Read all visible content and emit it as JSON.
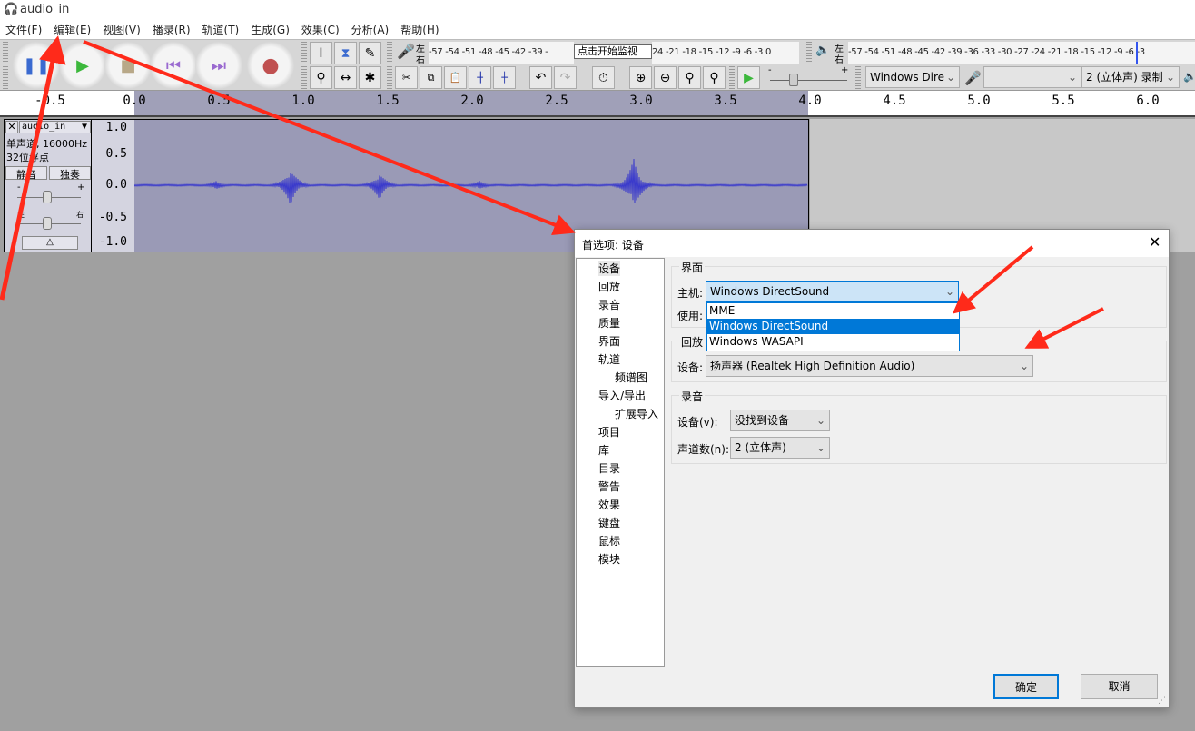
{
  "window": {
    "title": "audio_in"
  },
  "menu": [
    "文件(F)",
    "编辑(E)",
    "视图(V)",
    "播录(R)",
    "轨道(T)",
    "生成(G)",
    "效果(C)",
    "分析(A)",
    "帮助(H)"
  ],
  "toolbar": {
    "rec_meter_lr": [
      "左",
      "右"
    ],
    "rec_meter_scale": "-57 -54 -51 -48 -45 -42 -39 -",
    "rec_meter_scale2": "24 -21 -18 -15 -12  -9  -6  -3  0",
    "monitor_hint": "点击开始监视",
    "play_meter_lr": [
      "左",
      "右"
    ],
    "play_meter_scale": "-57 -54 -51 -48 -45 -42 -39 -36 -33 -30 -27 -24 -21 -18 -15 -12  -9  -6  -3",
    "speed_min": "-",
    "speed_max": "+",
    "host": "Windows Dire",
    "rec_device": "",
    "channels": "2 (立体声) 录制"
  },
  "ruler": {
    "ticks": [
      "-0.5",
      "0.0",
      "0.5",
      "1.0",
      "1.5",
      "2.0",
      "2.5",
      "3.0",
      "3.5",
      "4.0",
      "4.5",
      "5.0",
      "5.5",
      "6.0"
    ]
  },
  "track": {
    "name": "audio_in",
    "info1": "单声道, 16000Hz",
    "info2": "32位浮点",
    "mute": "静音",
    "solo": "独奏",
    "gain_min": "-",
    "gain_max": "+",
    "pan_left": "左",
    "pan_right": "右",
    "scale": [
      "1.0",
      "0.5",
      "0.0",
      "-0.5",
      "-1.0"
    ]
  },
  "dialog": {
    "title": "首选项: 设备",
    "tree": [
      "设备",
      "回放",
      "录音",
      "质量",
      "界面",
      "轨道",
      "频谱图",
      "导入/导出",
      "扩展导入",
      "项目",
      "库",
      "目录",
      "警告",
      "效果",
      "键盘",
      "鼠标",
      "模块"
    ],
    "interface_group": "界面",
    "host_label": "主机:",
    "host_value": "Windows DirectSound",
    "use_label": "使用:",
    "host_options": [
      "MME",
      "Windows DirectSound",
      "Windows WASAPI"
    ],
    "playback_group": "回放",
    "playback_device_label": "设备:",
    "playback_device": "扬声器 (Realtek High Definition Audio)",
    "recording_group": "录音",
    "recording_device_label": "设备(v):",
    "recording_device": "没找到设备",
    "channels_label": "声道数(n):",
    "channels_value": "2 (立体声)",
    "ok": "确定",
    "cancel": "取消"
  },
  "colors": {
    "annotation_arrow": "#ff2a1a",
    "selection": "#0078d7",
    "waveform": "#3a3acc"
  }
}
